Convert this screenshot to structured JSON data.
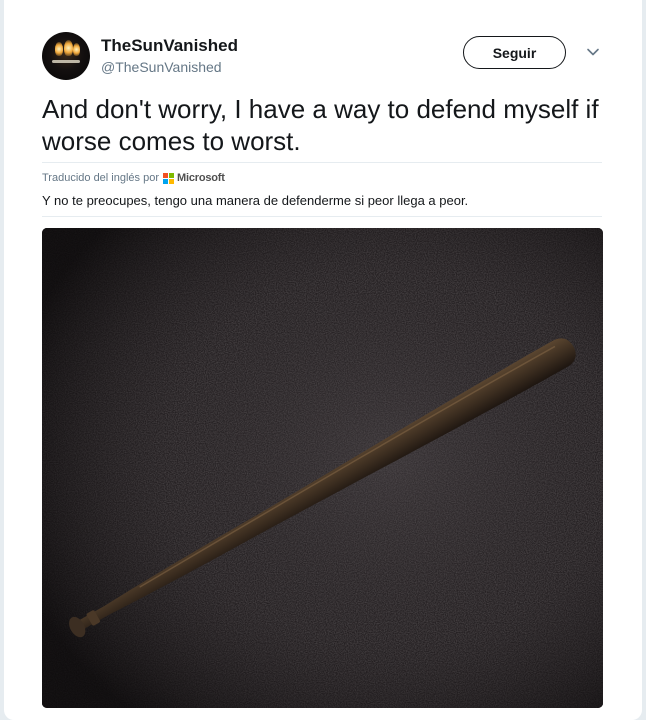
{
  "tweet": {
    "display_name": "TheSunVanished",
    "handle": "@TheSunVanished",
    "follow_label": "Seguir",
    "text": "And don't worry, I have a way to defend myself if worse comes to worst.",
    "translated_from": "Traducido del inglés por",
    "translator": "Microsoft",
    "translation": "Y no te preocupes, tengo una manera de defenderme si peor llega a peor."
  },
  "colors": {
    "text_primary": "#14171a",
    "text_secondary": "#657786",
    "divider": "#e6ecf0",
    "page_background": "#e6ecf0",
    "ms_red": "#f25022",
    "ms_green": "#7fba00",
    "ms_blue": "#00a4ef",
    "ms_yellow": "#ffb900"
  },
  "icons": {
    "menu": "chevron-down-icon",
    "translator_logo": "microsoft-logo-icon"
  }
}
